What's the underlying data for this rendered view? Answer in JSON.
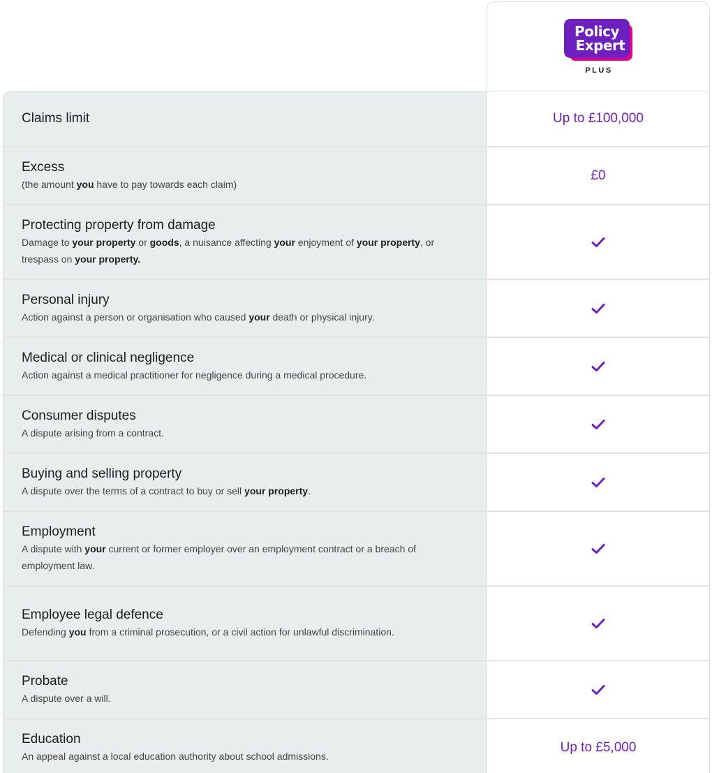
{
  "header": {
    "logo_line1": "Policy",
    "logo_line2": "Expert",
    "plan_name": "PLUS"
  },
  "colors": {
    "accent": "#6d1fbf",
    "brand_pink": "#e5008a",
    "label_bg": "#e8eded"
  },
  "rows": [
    {
      "title": "Claims limit",
      "desc_parts": [],
      "value": "Up to £100,000",
      "height": 80
    },
    {
      "title": "Excess",
      "desc_parts": [
        [
          "(the amount ",
          false
        ],
        [
          "you",
          true
        ],
        [
          " have to pay towards each claim)",
          false
        ]
      ],
      "value": "£0",
      "height": 83
    },
    {
      "title": "Protecting property from damage",
      "desc_parts": [
        [
          "Damage to ",
          false
        ],
        [
          "your property",
          true
        ],
        [
          " or ",
          false
        ],
        [
          "goods",
          true
        ],
        [
          ", a nuisance affecting ",
          false
        ],
        [
          "your",
          true
        ],
        [
          " enjoyment of ",
          false
        ],
        [
          "your property",
          true
        ],
        [
          ", or trespass on ",
          false
        ],
        [
          "your property.",
          true
        ]
      ],
      "value": "check-icon",
      "height": 107
    },
    {
      "title": "Personal injury",
      "desc_parts": [
        [
          "Action against a person or organisation who caused ",
          false
        ],
        [
          "your",
          true
        ],
        [
          " death or physical injury.",
          false
        ]
      ],
      "value": "check-icon",
      "height": 83
    },
    {
      "title": "Medical or clinical negligence",
      "desc_parts": [
        [
          "Action against a medical practitioner for negligence during a medical procedure.",
          false
        ]
      ],
      "value": "check-icon",
      "height": 83
    },
    {
      "title": "Consumer disputes",
      "desc_parts": [
        [
          "A dispute arising from a contract.",
          false
        ]
      ],
      "value": "check-icon",
      "height": 83
    },
    {
      "title": "Buying and selling property",
      "desc_parts": [
        [
          "A dispute over the terms of a contract to buy or sell ",
          false
        ],
        [
          "your property",
          true
        ],
        [
          ".",
          false
        ]
      ],
      "value": "check-icon",
      "height": 83
    },
    {
      "title": "Employment",
      "desc_parts": [
        [
          "A dispute with ",
          false
        ],
        [
          "your",
          true
        ],
        [
          " current or former employer over an employment contract or a breach of employment law.",
          false
        ]
      ],
      "value": "check-icon",
      "height": 107
    },
    {
      "title": "Employee legal defence",
      "desc_parts": [
        [
          "Defending ",
          false
        ],
        [
          "you",
          true
        ],
        [
          " from a criminal prosecution, or a civil action for unlawful discrimination.",
          false
        ]
      ],
      "value": "check-icon",
      "height": 107
    },
    {
      "title": "Probate",
      "desc_parts": [
        [
          "A dispute over a will.",
          false
        ]
      ],
      "value": "check-icon",
      "height": 83
    },
    {
      "title": "Education",
      "desc_parts": [
        [
          "An appeal against a local education authority about school admissions.",
          false
        ]
      ],
      "value": "Up to £5,000",
      "height": 83
    }
  ]
}
